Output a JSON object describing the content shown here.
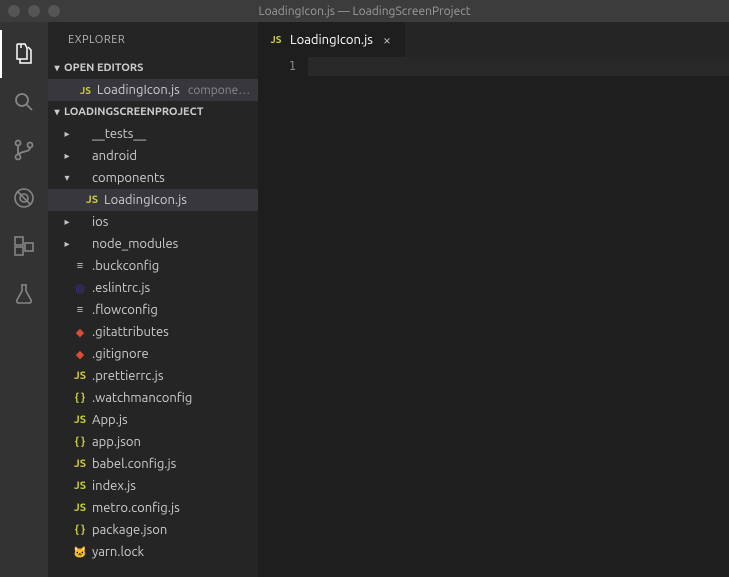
{
  "title": "LoadingIcon.js — LoadingScreenProject",
  "sidebar": {
    "title": "EXPLORER",
    "openEditors": {
      "header": "OPEN EDITORS",
      "items": [
        {
          "name": "LoadingIcon.js",
          "detail": "compone…",
          "icon": "js"
        }
      ]
    },
    "project": {
      "header": "LOADINGSCREENPROJECT"
    }
  },
  "tree": [
    {
      "label": "__tests__",
      "type": "folder",
      "depth": 0,
      "expanded": false
    },
    {
      "label": "android",
      "type": "folder",
      "depth": 0,
      "expanded": false
    },
    {
      "label": "components",
      "type": "folder",
      "depth": 0,
      "expanded": true
    },
    {
      "label": "LoadingIcon.js",
      "type": "js",
      "depth": 1,
      "selected": true
    },
    {
      "label": "ios",
      "type": "folder",
      "depth": 0,
      "expanded": false
    },
    {
      "label": "node_modules",
      "type": "folder",
      "depth": 0,
      "expanded": false
    },
    {
      "label": ".buckconfig",
      "type": "file",
      "depth": 0
    },
    {
      "label": ".eslintrc.js",
      "type": "eslint",
      "depth": 0
    },
    {
      "label": ".flowconfig",
      "type": "file",
      "depth": 0
    },
    {
      "label": ".gitattributes",
      "type": "git",
      "depth": 0
    },
    {
      "label": ".gitignore",
      "type": "git",
      "depth": 0
    },
    {
      "label": ".prettierrc.js",
      "type": "js",
      "depth": 0
    },
    {
      "label": ".watchmanconfig",
      "type": "json",
      "depth": 0
    },
    {
      "label": "App.js",
      "type": "js",
      "depth": 0
    },
    {
      "label": "app.json",
      "type": "json",
      "depth": 0
    },
    {
      "label": "babel.config.js",
      "type": "js",
      "depth": 0
    },
    {
      "label": "index.js",
      "type": "js",
      "depth": 0
    },
    {
      "label": "metro.config.js",
      "type": "js",
      "depth": 0
    },
    {
      "label": "package.json",
      "type": "json",
      "depth": 0
    },
    {
      "label": "yarn.lock",
      "type": "yarn",
      "depth": 0
    }
  ],
  "tabs": [
    {
      "label": "LoadingIcon.js",
      "icon": "js"
    }
  ],
  "editor": {
    "lineNumbers": [
      "1"
    ]
  },
  "icons": {
    "js": "JS",
    "json": "{ }",
    "file": "≡",
    "git": "◆",
    "eslint": "◎",
    "yarn": "🐱",
    "folderClosed": "▸",
    "folderOpen": "▾"
  }
}
